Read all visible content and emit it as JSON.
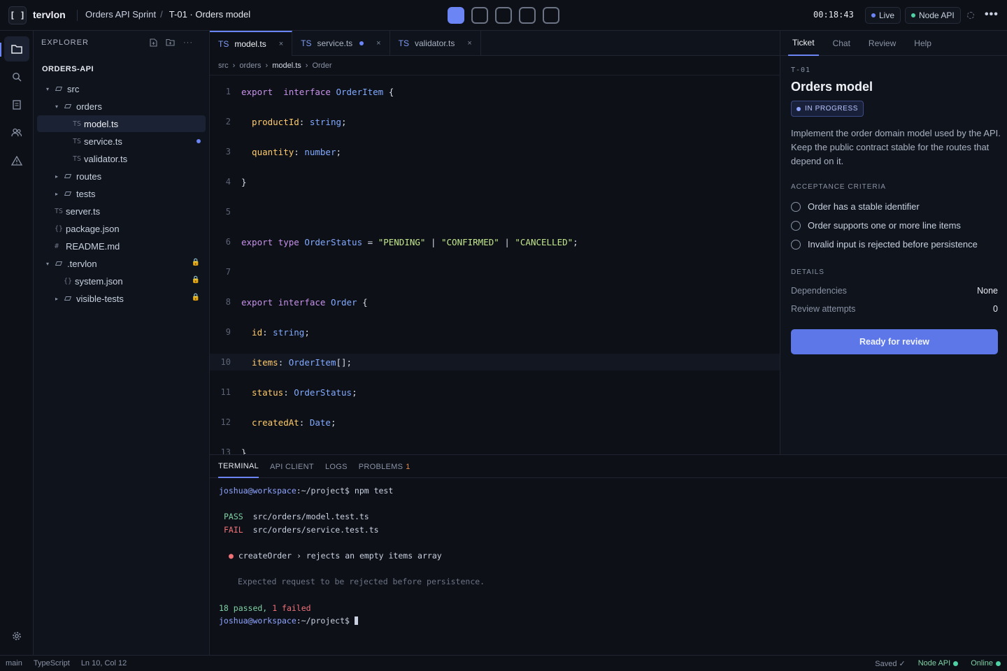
{
  "app": {
    "brand": "tervlon",
    "logo_glyph": "[ ]"
  },
  "header": {
    "project": "Orders API Sprint",
    "separator": "/",
    "ticket_path": "T-01 · Orders model",
    "timer": "00:18:43",
    "live_label": "Live",
    "env_label": "Node API",
    "steps": [
      {
        "state": "active"
      },
      {
        "state": "pending"
      },
      {
        "state": "pending"
      },
      {
        "state": "pending"
      },
      {
        "state": "pending"
      }
    ],
    "colors": {
      "accent": "#6b85f5",
      "live_dot": "#6b85f5",
      "env_dot": "#4fd1a4"
    }
  },
  "activity": {
    "icons": [
      "folder-icon",
      "search-icon",
      "document-icon",
      "users-icon",
      "warning-icon",
      "gear-icon"
    ]
  },
  "explorer": {
    "title": "EXPLORER",
    "project": "ORDERS-API",
    "tree": [
      {
        "label": "src",
        "type": "folder",
        "open": true,
        "depth": 0
      },
      {
        "label": "orders",
        "type": "folder",
        "open": true,
        "depth": 1
      },
      {
        "label": "model.ts",
        "type": "file",
        "ext": "TS",
        "depth": 2,
        "selected": true
      },
      {
        "label": "service.ts",
        "type": "file",
        "ext": "TS",
        "depth": 2,
        "modified": true
      },
      {
        "label": "validator.ts",
        "type": "file",
        "ext": "TS",
        "depth": 2
      },
      {
        "label": "routes",
        "type": "folder",
        "open": false,
        "depth": 1
      },
      {
        "label": "tests",
        "type": "folder",
        "open": false,
        "depth": 1
      },
      {
        "label": "server.ts",
        "type": "file",
        "ext": "TS",
        "depth": 0
      },
      {
        "label": "package.json",
        "type": "file",
        "ext": "{}",
        "depth": 0
      },
      {
        "label": "README.md",
        "type": "file",
        "ext": "#",
        "depth": 0
      },
      {
        "label": ".tervlon",
        "type": "folder",
        "open": true,
        "depth": 0,
        "locked": true
      },
      {
        "label": "system.json",
        "type": "file",
        "ext": "{}",
        "depth": 1,
        "locked": true
      },
      {
        "label": "visible-tests",
        "type": "folder",
        "open": false,
        "depth": 1,
        "locked": true
      }
    ]
  },
  "editor": {
    "tabs": [
      {
        "ext": "TS",
        "label": "model.ts",
        "active": true,
        "close": "×"
      },
      {
        "ext": "TS",
        "label": "service.ts",
        "modified": true,
        "close": "×"
      },
      {
        "ext": "TS",
        "label": "validator.ts",
        "close": "×"
      }
    ],
    "breadcrumb": [
      "src",
      "orders",
      "model.ts",
      "Order"
    ],
    "breadcrumb_sep": "›",
    "current_line": 10,
    "lines": [
      [
        [
          "kw",
          "export"
        ],
        [
          "",
          "  "
        ],
        [
          "kw",
          "interface"
        ],
        [
          "",
          ""
        ],
        [
          "ty",
          " OrderItem"
        ],
        [
          "",
          " {"
        ]
      ],
      [
        [
          "",
          ""
        ]
      ],
      [
        [
          "pr",
          "  productId"
        ],
        [
          "",
          ": "
        ],
        [
          "ty",
          "string"
        ],
        [
          "",
          ";"
        ]
      ],
      [
        [
          "",
          ""
        ]
      ],
      [
        [
          "pr",
          "  quantity"
        ],
        [
          "",
          ": "
        ],
        [
          "ty",
          "number"
        ],
        [
          "",
          ";"
        ]
      ],
      [
        [
          "",
          ""
        ]
      ],
      [
        [
          "",
          "}"
        ]
      ],
      [
        [
          "",
          ""
        ]
      ],
      [
        [
          "",
          ""
        ]
      ],
      [
        [
          "",
          ""
        ]
      ],
      [
        [
          "kw",
          "export"
        ],
        [
          "",
          " "
        ],
        [
          "kw",
          "type"
        ],
        [
          "ty",
          " OrderStatus"
        ],
        [
          "",
          " = "
        ],
        [
          "st",
          "\"PENDING\""
        ],
        [
          "",
          " | "
        ],
        [
          "st",
          "\"CONFIRMED\""
        ],
        [
          "",
          " | "
        ],
        [
          "st",
          "\"CANCELLED\""
        ],
        [
          "",
          ";"
        ]
      ],
      [
        [
          "",
          ""
        ]
      ],
      [
        [
          "",
          ""
        ]
      ],
      [
        [
          "",
          ""
        ]
      ],
      [
        [
          "kw",
          "export"
        ],
        [
          "",
          " "
        ],
        [
          "kw",
          "interface"
        ],
        [
          "ty",
          " Order"
        ],
        [
          "",
          " {"
        ]
      ],
      [
        [
          "",
          ""
        ]
      ],
      [
        [
          "pr",
          "  id"
        ],
        [
          "",
          ": "
        ],
        [
          "ty",
          "string"
        ],
        [
          "",
          ";"
        ]
      ],
      [
        [
          "",
          ""
        ]
      ],
      [
        [
          "pr",
          "  items"
        ],
        [
          "",
          ": "
        ],
        [
          "ty",
          "OrderItem"
        ],
        [
          "",
          "[];"
        ]
      ],
      [
        [
          "",
          ""
        ]
      ],
      [
        [
          "pr",
          "  status"
        ],
        [
          "",
          ": "
        ],
        [
          "ty",
          "OrderStatus"
        ],
        [
          "",
          ";"
        ]
      ],
      [
        [
          "",
          ""
        ]
      ],
      [
        [
          "pr",
          "  createdAt"
        ],
        [
          "",
          ": "
        ],
        [
          "ty",
          "Date"
        ],
        [
          "",
          ";"
        ]
      ],
      [
        [
          "",
          ""
        ]
      ],
      [
        [
          "",
          "}"
        ]
      ]
    ]
  },
  "ticket": {
    "tabs": [
      "Ticket",
      "Chat",
      "Review",
      "Help"
    ],
    "id": "T-01",
    "title": "Orders model",
    "status": "IN PROGRESS",
    "description": "Implement the order domain model used by the API. Keep the public contract stable for the routes that depend on it.",
    "criteria_heading": "ACCEPTANCE CRITERIA",
    "criteria": [
      "Order has a stable identifier",
      "Order supports one or more line items",
      "Invalid input is rejected before persistence"
    ],
    "details_heading": "DETAILS",
    "details": [
      {
        "label": "Dependencies",
        "value": "None"
      },
      {
        "label": "Review attempts",
        "value": "0"
      }
    ],
    "cta": "Ready for review"
  },
  "bottom": {
    "tabs": [
      {
        "label": "TERMINAL",
        "active": true
      },
      {
        "label": "API CLIENT"
      },
      {
        "label": "LOGS"
      },
      {
        "label": "PROBLEMS",
        "count": "1"
      }
    ],
    "terminal": {
      "prompt_user": "joshua@workspace",
      "prompt_path": ":~/project$",
      "command": "npm test",
      "pass_tag": "PASS",
      "pass_file": "src/orders/model.test.ts",
      "fail_tag": "FAIL",
      "fail_file": "src/orders/service.test.ts",
      "failure_title": "createOrder › rejects an empty items array",
      "failure_detail": "Expected request to be rejected before persistence.",
      "summary_passed": "18 passed,",
      "summary_failed": "1 failed"
    }
  },
  "statusbar": {
    "branch": "main",
    "language": "TypeScript",
    "cursor": "Ln 10, Col 12",
    "saved": "Saved ✓",
    "env": "Node API",
    "online": "Online"
  }
}
